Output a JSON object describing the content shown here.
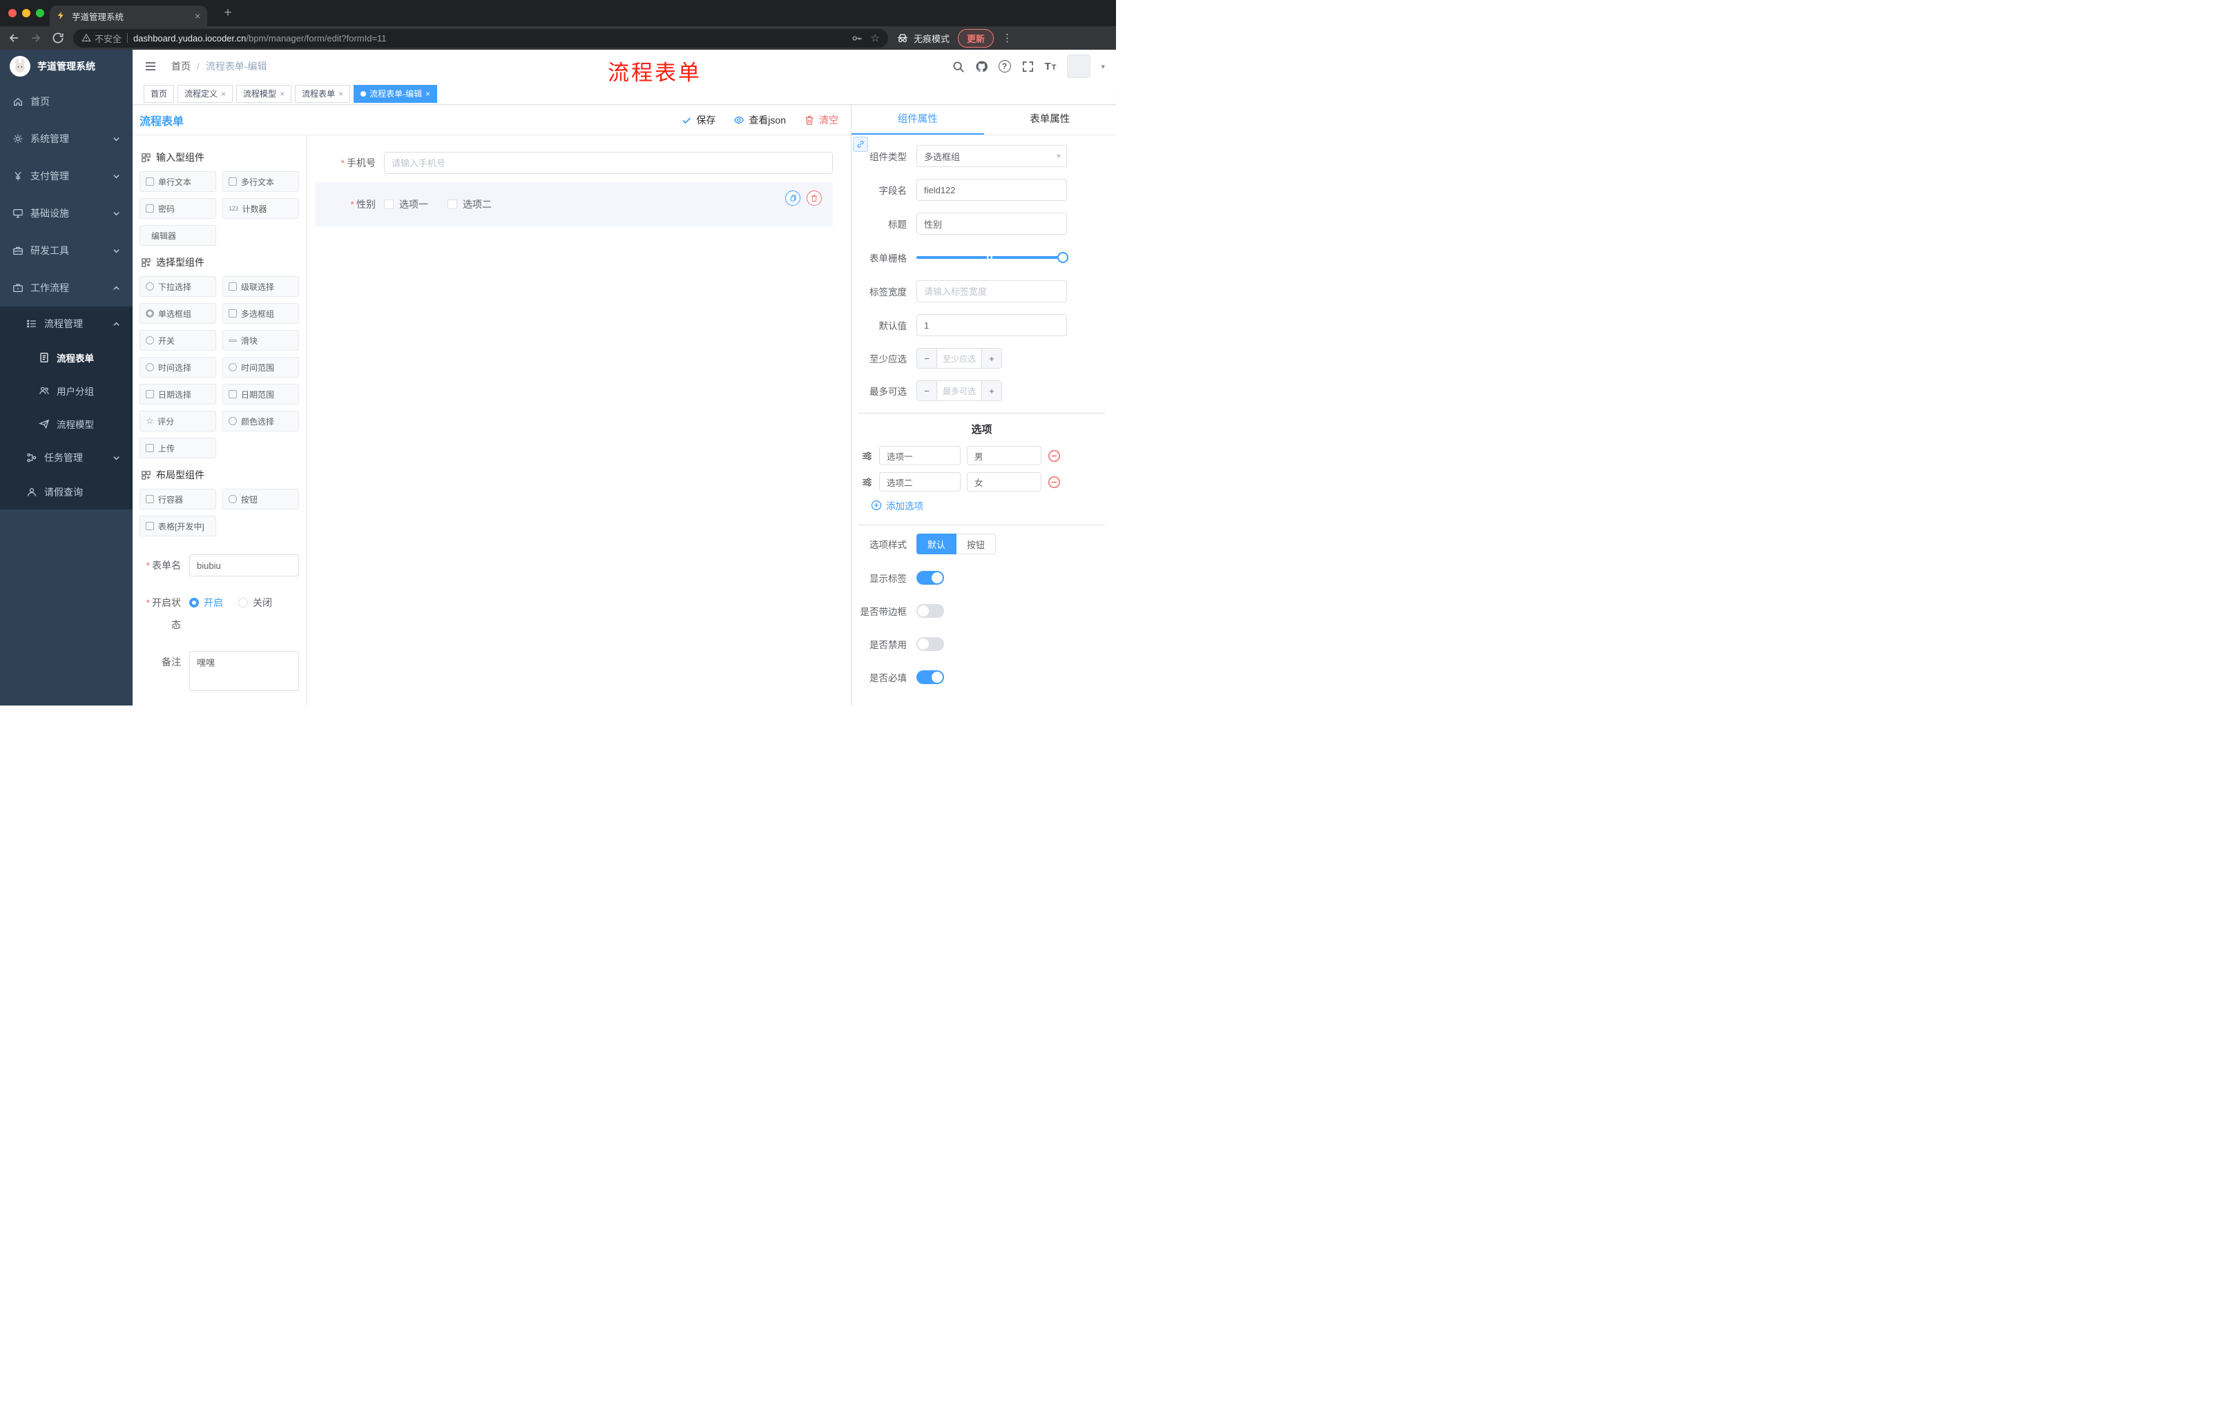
{
  "glyphs": {
    "close": "×",
    "plus": "+",
    "minus": "−",
    "asterisk": "*",
    "breadcrumb_sep": "/",
    "kebab": "⋮",
    "caret": "▾",
    "star": "☆",
    "counter": "123"
  },
  "colors": {
    "primary": "#409eff",
    "danger": "#f56c6c",
    "sidebar": "#304156",
    "sidebar_sub": "#1f2d3d"
  },
  "browser": {
    "tab": {
      "title": "芋道管理系统"
    },
    "address": {
      "security_label": "不安全",
      "domain": "dashboard.yudao.iocoder.cn",
      "path": "/bpm/manager/form/edit?formId=11"
    },
    "incognito_label": "无痕模式",
    "update_label": "更新"
  },
  "sidebar": {
    "logo_title": "芋道管理系统",
    "items": [
      {
        "label": "首页",
        "icon": "dashboard-icon",
        "level": 1
      },
      {
        "label": "系统管理",
        "icon": "gear-icon",
        "level": 1,
        "chevron": "down"
      },
      {
        "label": "支付管理",
        "icon": "yen-icon",
        "level": 1,
        "chevron": "down"
      },
      {
        "label": "基础设施",
        "icon": "monitor-icon",
        "level": 1,
        "chevron": "down"
      },
      {
        "label": "研发工具",
        "icon": "toolbox-icon",
        "level": 1,
        "chevron": "down"
      },
      {
        "label": "工作流程",
        "icon": "briefcase-icon",
        "level": 1,
        "chevron": "up",
        "expanded": true
      },
      {
        "label": "流程管理",
        "icon": "list-icon",
        "level": 2,
        "chevron": "up",
        "expanded": true
      },
      {
        "label": "流程表单",
        "icon": "document-icon",
        "level": 3,
        "active": true
      },
      {
        "label": "用户分组",
        "icon": "users-icon",
        "level": 3
      },
      {
        "label": "流程模型",
        "icon": "send-icon",
        "level": 3
      },
      {
        "label": "任务管理",
        "icon": "tasks-icon",
        "level": 2,
        "chevron": "down"
      },
      {
        "label": "请假查询",
        "icon": "user-icon",
        "level": 2
      }
    ]
  },
  "header": {
    "breadcrumb": {
      "home": "首页",
      "current": "流程表单-编辑"
    },
    "annotation": "流程表单"
  },
  "tags": {
    "items": [
      {
        "label": "首页",
        "active": false,
        "closable": false
      },
      {
        "label": "流程定义",
        "active": false,
        "closable": true
      },
      {
        "label": "流程模型",
        "active": false,
        "closable": true
      },
      {
        "label": "流程表单",
        "active": false,
        "closable": true
      },
      {
        "label": "流程表单-编辑",
        "active": true,
        "closable": true
      }
    ]
  },
  "designer": {
    "panel_title": "流程表单",
    "toolbar": {
      "save": "保存",
      "view_json": "查看json",
      "clear": "清空"
    },
    "palette": {
      "groups": [
        {
          "title": "输入型组件",
          "items": [
            "单行文本",
            "多行文本",
            "密码",
            "计数器",
            "编辑器"
          ]
        },
        {
          "title": "选择型组件",
          "items": [
            "下拉选择",
            "级联选择",
            "单选框组",
            "多选框组",
            "开关",
            "滑块",
            "时间选择",
            "时间范围",
            "日期选择",
            "日期范围",
            "评分",
            "颜色选择",
            "上传"
          ]
        },
        {
          "title": "布局型组件",
          "items": [
            "行容器",
            "按钮",
            "表格[开发中]"
          ]
        }
      ]
    },
    "meta": {
      "form_name": {
        "label": "表单名",
        "value": "biubiu"
      },
      "status": {
        "label": "开启状态",
        "on": "开启",
        "off": "关闭",
        "selected": "开启"
      },
      "remark": {
        "label": "备注",
        "value": "嘿嘿"
      }
    },
    "canvas": {
      "phone": {
        "label": "手机号",
        "required": true,
        "placeholder": "请输入手机号"
      },
      "gender": {
        "label": "性别",
        "required": true,
        "option1": "选项一",
        "option2": "选项二",
        "selected_component": true
      }
    }
  },
  "properties": {
    "tabs": {
      "component": "组件属性",
      "form": "表单属性",
      "active": "组件属性"
    },
    "fields": {
      "component_type": {
        "label": "组件类型",
        "value": "多选框组"
      },
      "field_name": {
        "label": "字段名",
        "value": "field122"
      },
      "title": {
        "label": "标题",
        "value": "性别"
      },
      "grid": {
        "label": "表单栅格"
      },
      "label_width": {
        "label": "标签宽度",
        "placeholder": "请输入标签宽度"
      },
      "default_value": {
        "label": "默认值",
        "value": "1"
      },
      "min_select": {
        "label": "至少应选",
        "placeholder": "至少应选"
      },
      "max_select": {
        "label": "最多可选",
        "placeholder": "最多可选"
      }
    },
    "options": {
      "title": "选项",
      "rows": [
        {
          "label": "选项一",
          "value": "男"
        },
        {
          "label": "选项二",
          "value": "女"
        }
      ],
      "add": "添加选项"
    },
    "style": {
      "label": "选项样式",
      "default": "默认",
      "button": "按钮",
      "active": "默认"
    },
    "switches": {
      "show_label": {
        "label": "显示标签",
        "on": true
      },
      "border": {
        "label": "是否带边框",
        "on": false
      },
      "disabled": {
        "label": "是否禁用",
        "on": false
      },
      "required": {
        "label": "是否必填",
        "on": true
      }
    }
  },
  "icons": [
    "favicon",
    "close-icon",
    "new-tab-icon",
    "back-icon",
    "forward-icon",
    "reload-icon",
    "warning-icon",
    "key-icon",
    "star-icon",
    "incognito-icon",
    "kebab-menu-icon",
    "hamburger-icon",
    "search-icon",
    "github-icon",
    "question-icon",
    "fullscreen-icon",
    "font-size-icon",
    "avatar",
    "check-icon",
    "eye-icon",
    "trash-icon",
    "copy-icon",
    "link-icon",
    "drag-handle-icon",
    "remove-option-icon",
    "add-circle-icon"
  ]
}
